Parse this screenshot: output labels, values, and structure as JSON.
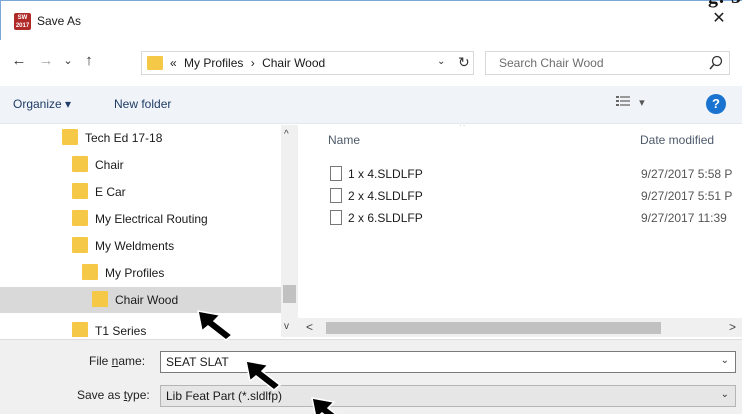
{
  "window": {
    "title": "Save As",
    "close_glyph": "✕",
    "app_icon_text": "SW 2017",
    "corner_partial_text": "g. 5"
  },
  "nav": {
    "back": "←",
    "forward": "→",
    "recent": "⌄",
    "up": "↑",
    "breadcrumbs": [
      "«",
      "My Profiles",
      "›",
      "Chair Wood"
    ],
    "address_dropdown": "⌄",
    "refresh": "↻",
    "search_placeholder": "Search Chair Wood"
  },
  "toolbar": {
    "organize": "Organize ▾",
    "new_folder": "New folder",
    "view_menu": "▾",
    "help": "?"
  },
  "tree": [
    {
      "label": "Tech Ed 17-18"
    },
    {
      "label": "Chair"
    },
    {
      "label": "E Car"
    },
    {
      "label": "My Electrical Routing"
    },
    {
      "label": "My Weldments"
    },
    {
      "label": "My Profiles"
    },
    {
      "label": "Chair Wood"
    },
    {
      "label": "T1 Series"
    }
  ],
  "columns": {
    "name": "Name",
    "date_modified": "Date modified"
  },
  "files": [
    {
      "name": "1 x 4.SLDLFP",
      "date": "9/27/2017 5:58 P"
    },
    {
      "name": "2 x 4.SLDLFP",
      "date": "9/27/2017 5:51 P"
    },
    {
      "name": "2 x 6.SLDLFP",
      "date": "9/27/2017 11:39"
    }
  ],
  "scroll": {
    "up": "^",
    "down": "v",
    "left": "<",
    "right": ">"
  },
  "form": {
    "file_name_label_pre": "File ",
    "file_name_label_u": "n",
    "file_name_label_post": "ame:",
    "file_name_value": "SEAT SLAT",
    "save_type_label_pre": "Save as ",
    "save_type_label_u": "t",
    "save_type_label_post": "ype:",
    "save_type_value": "Lib Feat Part (*.sldlfp)",
    "dropdown": "⌄"
  },
  "colors": {
    "folder": "#f5c947",
    "selection": "#d9d9d9",
    "help": "#1a73d1",
    "link": "#1f3c66"
  }
}
